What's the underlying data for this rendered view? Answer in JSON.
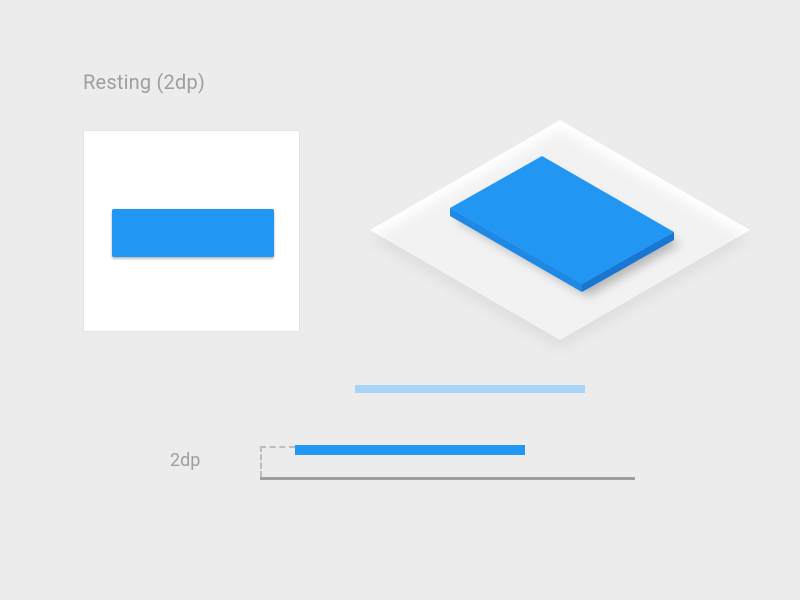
{
  "title": "Resting (2dp)",
  "elevation_label": "2dp",
  "colors": {
    "button": "#2196F3",
    "button_tint": "#A8D5F7",
    "surface": "#FFFFFF",
    "ground": "#9E9E9E",
    "leader": "#BDBDBD",
    "background": "#ECECEC",
    "text_muted": "#9E9E9E"
  },
  "elevation_dp": 2
}
